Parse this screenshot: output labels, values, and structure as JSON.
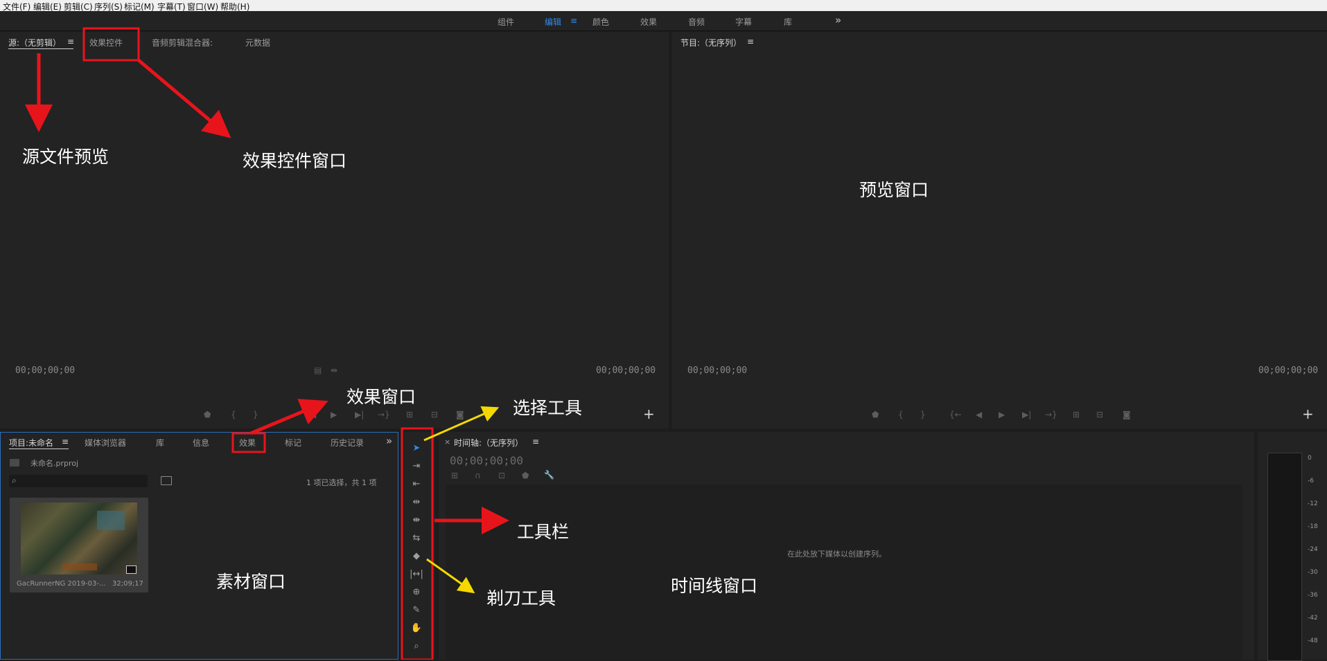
{
  "menu": [
    "文件(F)",
    "编辑(E)",
    "剪辑(C)",
    "序列(S)",
    "标记(M)",
    "字幕(T)",
    "窗口(W)",
    "帮助(H)"
  ],
  "workspaces": [
    "组件",
    "编辑",
    "颜色",
    "效果",
    "音频",
    "字幕",
    "库"
  ],
  "active_workspace": "编辑",
  "more_glyph": "»",
  "menu_glyph": "≡",
  "source_panel": {
    "tabs": [
      "源:（无剪辑）",
      "效果控件",
      "音频剪辑混合器:",
      "元数据"
    ],
    "timecode_left": "00;00;00;00",
    "timecode_right": "00;00;00;00",
    "add_glyph": "+"
  },
  "program_panel": {
    "title": "节目:（无序列）",
    "timecode_left": "00;00;00;00",
    "timecode_right": "00;00;00;00",
    "add_glyph": "+"
  },
  "project_panel": {
    "tabs": [
      "项目:未命名",
      "媒体浏览器",
      "库",
      "信息",
      "效果",
      "标记",
      "历史记录"
    ],
    "file": "未命名.prproj",
    "selection_info": "1 项已选择，共 1 项",
    "clip_name": "GacRunnerNG 2019-03-...",
    "clip_duration": "32;09;17"
  },
  "timeline_panel": {
    "title": "时间轴:（无序列）",
    "timecode": "00;00;00;00",
    "hint": "在此处放下媒体以创建序列。",
    "close_glyph": "×"
  },
  "meter_labels": [
    "0",
    "-6",
    "-12",
    "-18",
    "-24",
    "-30",
    "-36",
    "-42",
    "-48"
  ],
  "tools": [
    "selection-tool",
    "track-select-tool",
    "ripple-edit-tool",
    "rolling-edit-tool",
    "rate-stretch-tool",
    "slip-tool",
    "razor-tool",
    "slide-tool",
    "pen-tool",
    "hand-tool",
    "zoom-tool"
  ],
  "annotations": {
    "source_preview": "源文件预览",
    "effect_controls": "效果控件窗口",
    "preview_window": "预览窗口",
    "effects_window": "效果窗口",
    "selection_tool": "选择工具",
    "toolbar": "工具栏",
    "razor_tool": "剃刀工具",
    "media_window": "素材窗口",
    "timeline_window": "时间线窗口"
  },
  "colors": {
    "accent_blue": "#2d8ceb",
    "annotation_red": "#e8141b",
    "annotation_yellow": "#f5d800"
  }
}
